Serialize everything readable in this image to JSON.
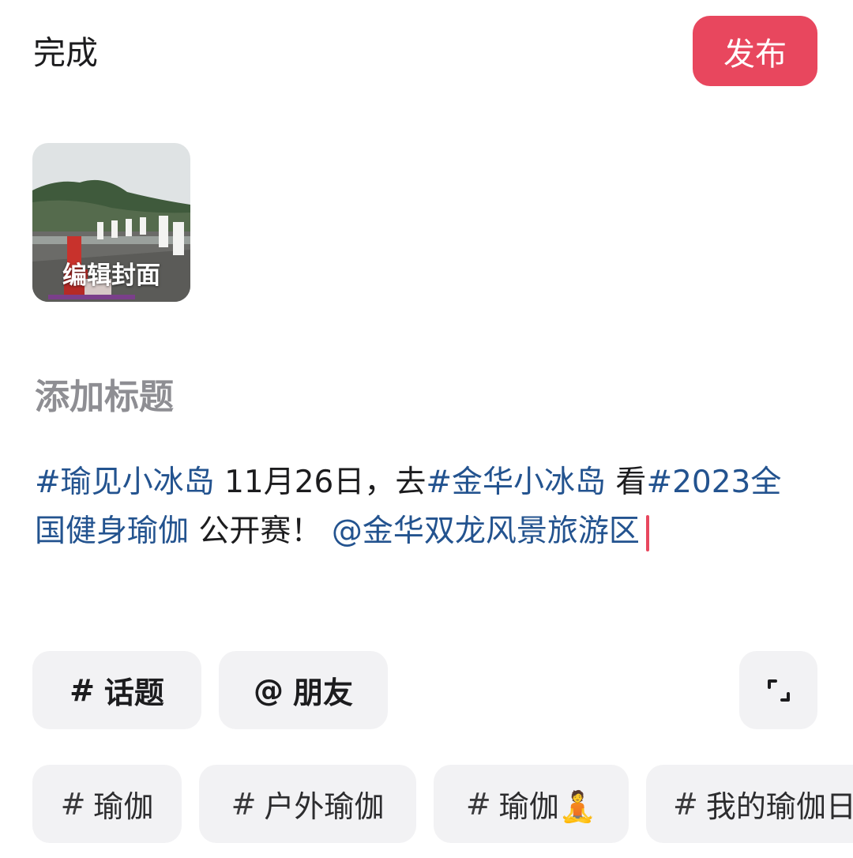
{
  "header": {
    "done_label": "完成",
    "publish_label": "发布",
    "publish_color": "#e8475e"
  },
  "cover": {
    "edit_label": "编辑封面"
  },
  "title_field": {
    "placeholder": "添加标题",
    "value": ""
  },
  "body": {
    "line1": [
      {
        "text": "#瑜见小冰岛",
        "tag": true
      },
      {
        "text": " 11月26日，去",
        "tag": false
      },
      {
        "text": "#金华小冰岛",
        "tag": true
      },
      {
        "text": " 看",
        "tag": false
      },
      {
        "text": "#2023全",
        "tag": true
      }
    ],
    "line2": [
      {
        "text": "国健身瑜伽",
        "tag": true
      },
      {
        "text": " 公开赛！ ",
        "tag": false
      },
      {
        "text": "@金华双龙风景旅游区",
        "tag": true
      }
    ],
    "tag_color": "#23538f"
  },
  "actions": {
    "topic_symbol": "#",
    "topic_label": "话题",
    "friend_symbol": "@",
    "friend_label": "朋友"
  },
  "suggestions": {
    "hash": "#",
    "items": [
      "瑜伽",
      "户外瑜伽",
      "瑜伽🧘",
      "我的瑜伽日"
    ]
  }
}
